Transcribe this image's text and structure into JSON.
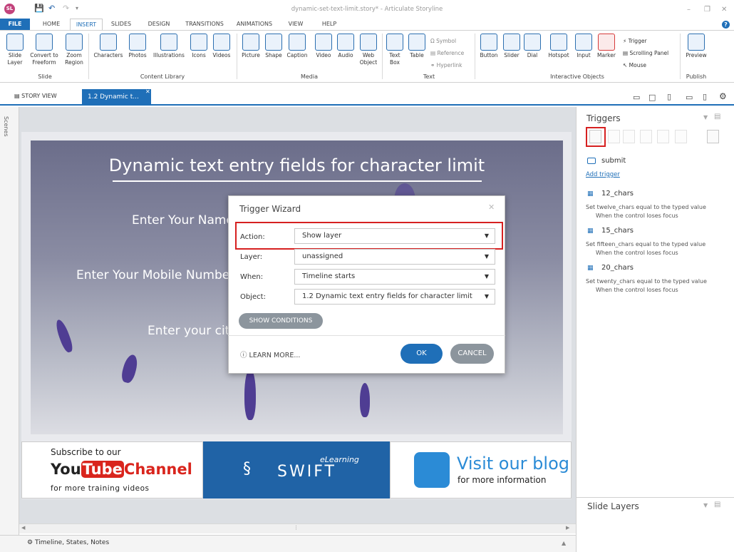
{
  "window": {
    "title": "dynamic-set-text-limit.story* - Articulate Storyline",
    "logo_text": "SL"
  },
  "tabs": [
    "FILE",
    "HOME",
    "INSERT",
    "SLIDES",
    "DESIGN",
    "TRANSITIONS",
    "ANIMATIONS",
    "VIEW",
    "HELP"
  ],
  "ribbon": {
    "slide_group": {
      "name": "Slide",
      "buttons": [
        "Slide Layer",
        "Convert to Freeform",
        "Zoom Region"
      ]
    },
    "content_group": {
      "name": "Content Library",
      "buttons": [
        "Characters",
        "Photos",
        "Illustrations",
        "Icons",
        "Videos"
      ]
    },
    "media_group": {
      "name": "Media",
      "buttons": [
        "Picture",
        "Shape",
        "Caption",
        "Video",
        "Audio",
        "Web Object"
      ]
    },
    "text_group": {
      "name": "Text",
      "buttons": [
        "Text Box",
        "Table"
      ],
      "small": [
        "Symbol",
        "Reference",
        "Hyperlink"
      ]
    },
    "interactive_group": {
      "name": "Interactive Objects",
      "buttons": [
        "Button",
        "Slider",
        "Dial",
        "Hotspot",
        "Input",
        "Marker"
      ],
      "small": [
        "Trigger",
        "Scrolling Panel",
        "Mouse"
      ]
    },
    "publish_group": {
      "name": "Publish",
      "buttons": [
        "Preview"
      ]
    }
  },
  "view_tabs": {
    "story_view": "STORY VIEW",
    "slide_tab": "1.2 Dynamic t..."
  },
  "scenes_label": "Scenes",
  "slide": {
    "title": "Dynamic text entry fields for character limit",
    "labels": [
      "Enter Your Name",
      "Enter Your Mobile Number",
      "Enter your city"
    ],
    "banner_left": {
      "line1": "Subscribe to our",
      "you": "You",
      "tube": "Tube",
      "channel": "Channel",
      "line3": "for more training videos"
    },
    "banner_mid": {
      "brand": "SWIFT",
      "sub": "eLearning"
    },
    "banner_right": {
      "line1": "Visit our blog",
      "line2": "for more information"
    }
  },
  "dialog": {
    "title": "Trigger Wizard",
    "rows": [
      {
        "label": "Action:",
        "value": "Show layer"
      },
      {
        "label": "Layer:",
        "value": "unassigned"
      },
      {
        "label": "When:",
        "value": "Timeline starts"
      },
      {
        "label": "Object:",
        "value": "1.2 Dynamic text entry fields for character limit"
      }
    ],
    "show_conditions": "SHOW CONDITIONS",
    "learn_more": "LEARN MORE...",
    "ok": "OK",
    "cancel": "CANCEL"
  },
  "triggers_panel": {
    "title": "Triggers",
    "items": [
      {
        "name": "submit",
        "add_link": "Add trigger"
      },
      {
        "name": "12_chars",
        "line1": "Set twelve_chars equal to the typed value",
        "line2": "When the control loses focus"
      },
      {
        "name": "15_chars",
        "line1": "Set fifteen_chars equal to the typed value",
        "line2": "When the control loses focus"
      },
      {
        "name": "20_chars",
        "line1": "Set twenty_chars equal to the typed value",
        "line2": "When the control loses focus"
      }
    ]
  },
  "slide_layers": {
    "title": "Slide Layers"
  },
  "status": {
    "timeline": "Timeline, States, Notes"
  },
  "colors": {
    "accent": "#1f6fb8",
    "highlight": "#d62020",
    "brand_bg": "#2063a6"
  }
}
